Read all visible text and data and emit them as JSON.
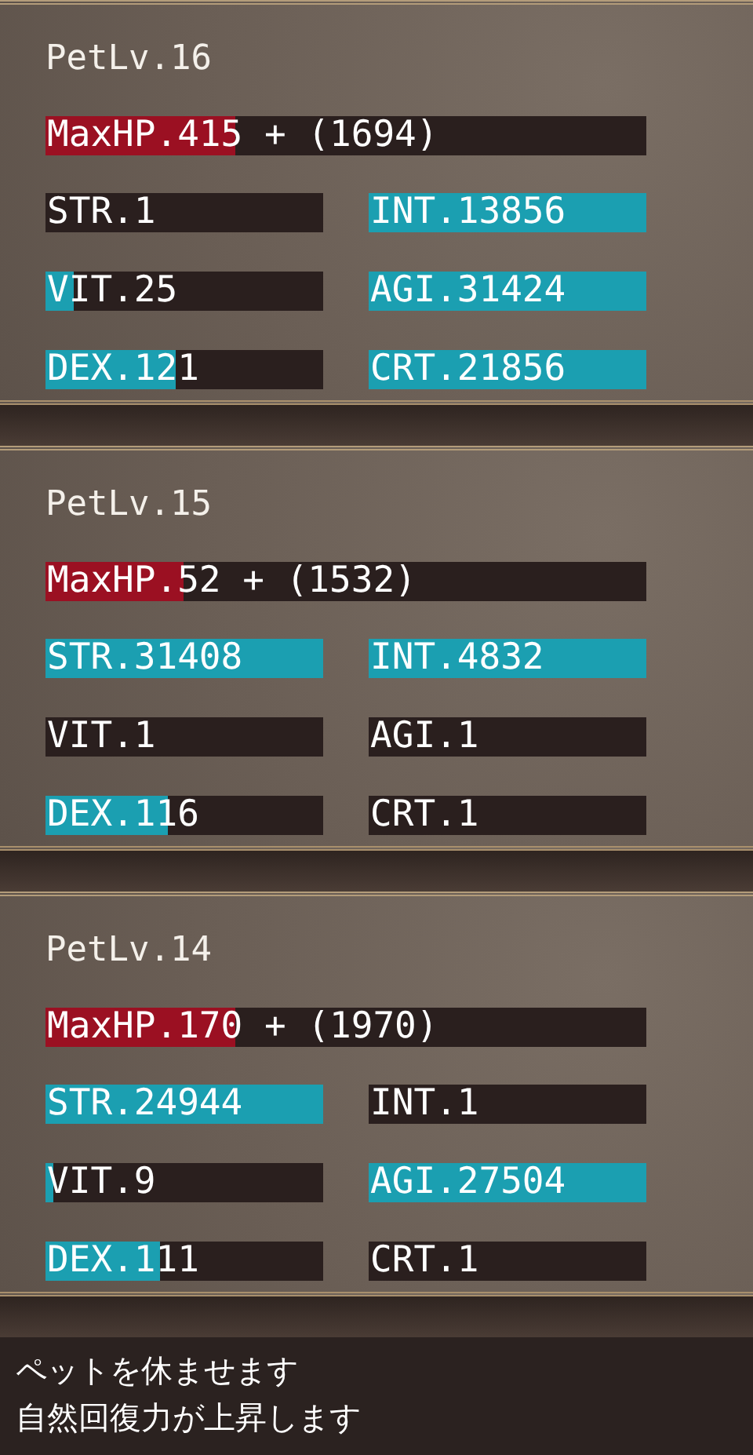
{
  "panels": [
    {
      "title": "PetLv.16",
      "bars": [
        {
          "kind": "hp",
          "label": "MaxHP.415 + (1694)",
          "level": 0.316
        },
        {
          "kind": "stat",
          "label": "STR.1",
          "level": 0
        },
        {
          "kind": "stat",
          "label": "INT.13856",
          "level": 1
        },
        {
          "kind": "stat",
          "label": "VIT.25",
          "level": 0.1
        },
        {
          "kind": "stat",
          "label": "AGI.31424",
          "level": 1
        },
        {
          "kind": "stat",
          "label": "DEX.121",
          "level": 0.47
        },
        {
          "kind": "stat",
          "label": "CRT.21856",
          "level": 1
        }
      ]
    },
    {
      "title": "PetLv.15",
      "bars": [
        {
          "kind": "hp",
          "label": "MaxHP.52 + (1532)",
          "level": 0.23
        },
        {
          "kind": "stat",
          "label": "STR.31408",
          "level": 1
        },
        {
          "kind": "stat",
          "label": "INT.4832",
          "level": 1
        },
        {
          "kind": "stat",
          "label": "VIT.1",
          "level": 0
        },
        {
          "kind": "stat",
          "label": "AGI.1",
          "level": 0
        },
        {
          "kind": "stat",
          "label": "DEX.116",
          "level": 0.44
        },
        {
          "kind": "stat",
          "label": "CRT.1",
          "level": 0
        }
      ]
    },
    {
      "title": "PetLv.14",
      "bars": [
        {
          "kind": "hp",
          "label": "MaxHP.170 + (1970)",
          "level": 0.316
        },
        {
          "kind": "stat",
          "label": "STR.24944",
          "level": 1
        },
        {
          "kind": "stat",
          "label": "INT.1",
          "level": 0
        },
        {
          "kind": "stat",
          "label": "VIT.9",
          "level": 0.03
        },
        {
          "kind": "stat",
          "label": "AGI.27504",
          "level": 1
        },
        {
          "kind": "stat",
          "label": "DEX.111",
          "level": 0.41
        },
        {
          "kind": "stat",
          "label": "CRT.1",
          "level": 0
        }
      ]
    }
  ],
  "message": [
    "ペットを休ませます",
    "自然回復力が上昇します"
  ]
}
